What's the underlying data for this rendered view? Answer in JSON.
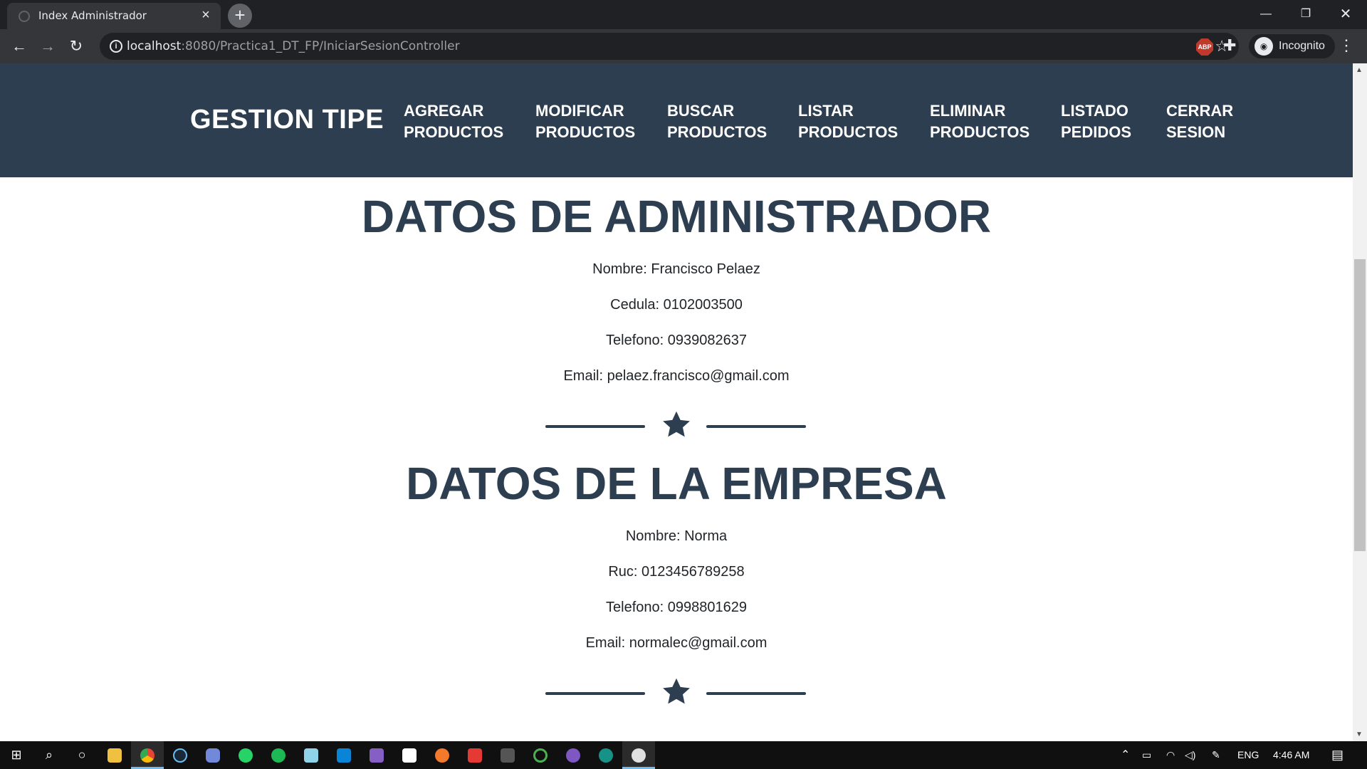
{
  "browser": {
    "tab_title": "Index Administrador",
    "url_host": "localhost",
    "url_path": ":8080/Practica1_DT_FP/IniciarSesionController",
    "incognito_label": "Incognito",
    "abp_label": "ABP"
  },
  "nav": {
    "brand": "GESTION TIPE",
    "items": [
      {
        "line1": "AGREGAR",
        "line2": "PRODUCTOS"
      },
      {
        "line1": "MODIFICAR",
        "line2": "PRODUCTOS"
      },
      {
        "line1": "BUSCAR",
        "line2": "PRODUCTOS"
      },
      {
        "line1": "LISTAR",
        "line2": "PRODUCTOS"
      },
      {
        "line1": "ELIMINAR",
        "line2": "PRODUCTOS"
      },
      {
        "line1": "LISTADO",
        "line2": "PEDIDOS"
      },
      {
        "line1": "CERRAR",
        "line2": "SESION"
      }
    ]
  },
  "admin": {
    "title": "DATOS DE ADMINISTRADOR",
    "nombre": "Nombre: Francisco Pelaez",
    "cedula": "Cedula: 0102003500",
    "telefono": "Telefono: 0939082637",
    "email": "Email: pelaez.francisco@gmail.com"
  },
  "empresa": {
    "title": "DATOS DE LA EMPRESA",
    "nombre": "Nombre: Norma",
    "ruc": "Ruc: 0123456789258",
    "telefono": "Telefono: 0998801629",
    "email": "Email: normalec@gmail.com"
  },
  "taskbar": {
    "language": "ENG",
    "time": "4:46 AM"
  },
  "colors": {
    "primary": "#2c3e50"
  }
}
